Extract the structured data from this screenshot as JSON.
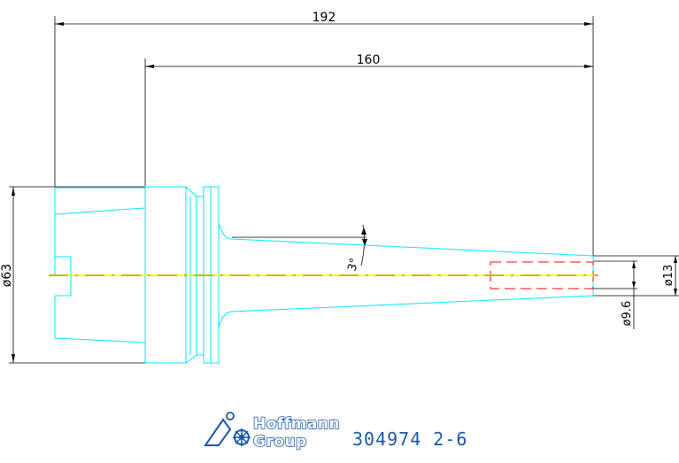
{
  "dimensions": {
    "overall_length": "192",
    "gauge_length": "160",
    "flange_diameter": "ø63",
    "taper_angle": "3°",
    "tip_diameter": "ø13",
    "bore_diameter": "ø9.6"
  },
  "title_block": {
    "brand_line1": "Hoffmann",
    "brand_line2": "Group",
    "part_number": "304974 2-6"
  },
  "colors": {
    "part_outline": "#00e5ff",
    "centerline": "#ffff00",
    "bore_hidden": "#ff0000",
    "dimension": "#000000",
    "brand": "#1b57a8"
  }
}
